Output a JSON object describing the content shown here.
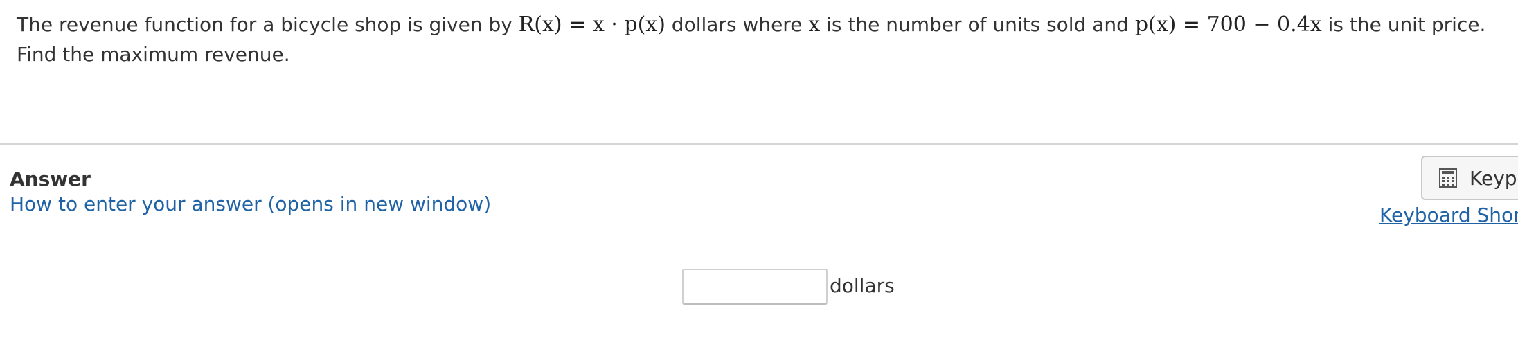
{
  "question": {
    "intro": "The revenue function for a bicycle shop is given by ",
    "math_revenue": "R(x) = x · p(x)",
    "mid": " dollars where ",
    "math_x": "x",
    "mid2": " is the number of units sold and ",
    "math_price": "p(x) = 700 − 0.4x",
    "outro": " is the unit price.  Find the maximum revenue."
  },
  "answer": {
    "heading": "Answer",
    "help_link": "How to enter your answer (opens in new window)",
    "keypad_label": "Keyp",
    "keyboard_shortcuts": "Keyboard Short",
    "input_value": "",
    "unit": "dollars"
  },
  "icons": {
    "keypad": "calculator-icon"
  },
  "colors": {
    "link": "#1f63a6",
    "text": "#333333",
    "divider": "#d4d4d4"
  }
}
